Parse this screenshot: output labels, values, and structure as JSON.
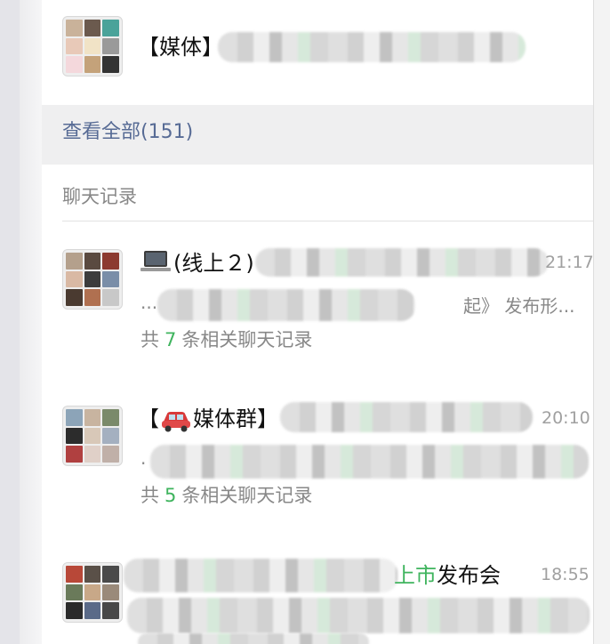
{
  "group_result": {
    "title": "【媒体】"
  },
  "see_all": {
    "label": "查看全部(151)"
  },
  "section": {
    "label": "聊天记录"
  },
  "chats": [
    {
      "title": "(线上２)",
      "time": "21:17",
      "snippet_prefix": "...",
      "snippet_suffix": "起》 发布形...",
      "count_prefix": "共",
      "count": "7",
      "count_suffix": "条相关聊天记录"
    },
    {
      "title": "【",
      "title_after": "媒体群】",
      "time": "20:10",
      "snippet_prefix": ".",
      "count_prefix": "共",
      "count": "5",
      "count_suffix": "条相关聊天记录"
    },
    {
      "title_green": "上市",
      "title_rest": "发布会",
      "time": "18:55"
    }
  ],
  "colors": {
    "link": "#576b95",
    "highlight": "#3fb45e",
    "secondary_text": "#888888"
  },
  "icons": {
    "laptop": "laptop-icon",
    "car": "car-icon"
  }
}
